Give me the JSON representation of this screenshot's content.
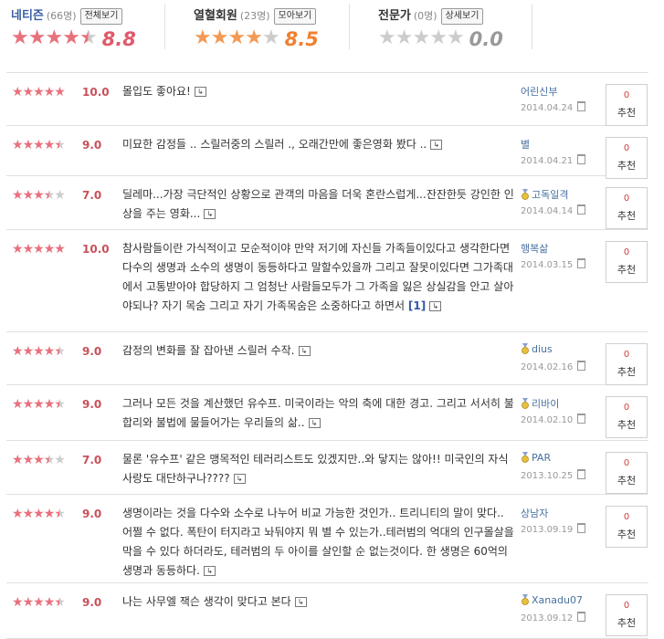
{
  "summary": {
    "groups": [
      {
        "label": "네티즌",
        "count": "(66명)",
        "button": "전체보기",
        "stars": "4.5",
        "score": "8.8",
        "score_color": "#e05a6a",
        "star_color": "#e8707c"
      },
      {
        "label": "열혈회원",
        "count": "(23명)",
        "button": "모아보기",
        "stars": "4",
        "score": "8.5",
        "score_color": "#f08030",
        "star_color": "#f39a55"
      },
      {
        "label": "전문가",
        "count": "(0명)",
        "button": "상세보기",
        "stars": "0",
        "score": "0.0",
        "score_color": "#999999",
        "star_color": "#cccccc"
      }
    ]
  },
  "reviews": [
    {
      "stars": "5",
      "score": "10.0",
      "text": "몰입도 좋아요!",
      "ref": "",
      "user": "어린신부",
      "medal": false,
      "date": "2014.04.24",
      "rec_count": "0",
      "rec_label": "추천"
    },
    {
      "stars": "4.5",
      "score": "9.0",
      "text": "미묘한 감정들 .. 스릴러중의 스릴러 ., 오래간만에 좋은영화 봤다 ..",
      "ref": "",
      "user": "별",
      "medal": false,
      "date": "2014.04.21",
      "rec_count": "0",
      "rec_label": "추천"
    },
    {
      "stars": "3.5",
      "score": "7.0",
      "text": "딜레마...가장 극단적인 상황으로 관객의 마음을 더욱 혼란스럽게...잔잔한듯 강인한 인상을 주는 영화...",
      "ref": "",
      "user": "고독일격",
      "medal": true,
      "date": "2014.04.14",
      "rec_count": "0",
      "rec_label": "추천"
    },
    {
      "stars": "5",
      "score": "10.0",
      "text": "참사람들이란 가식적이고 모순적이야 만약 저기에 자신들 가족들이있다고 생각한다면 다수의 생명과 소수의 생명이 동등하다고 말할수있을까 그리고 잘못이있다면 그가족대에서 고통받아야 합당하지 그 엄청난 사람들모두가 그 가족을 잃은 상실감을 안고 살아야되나? 자기 목숨 그리고 자기 가족목숨은 소중하다고 하면서",
      "ref": "[1]",
      "user": "행복삶",
      "medal": false,
      "date": "2014.03.15",
      "rec_count": "0",
      "rec_label": "추천"
    },
    {
      "stars": "4.5",
      "score": "9.0",
      "text": "감정의 변화를 잘 잡아낸 스릴러 수작.",
      "ref": "",
      "user": "dius",
      "medal": true,
      "date": "2014.02.16",
      "rec_count": "0",
      "rec_label": "추천"
    },
    {
      "stars": "4.5",
      "score": "9.0",
      "text": "그러나 모든 것을 계산했던 유수프. 미국이라는 악의 축에 대한 경고. 그리고 서서히 불합리와 불법에 물들어가는 우리들의 삶..",
      "ref": "",
      "user": "리바이",
      "medal": true,
      "date": "2014.02.10",
      "rec_count": "0",
      "rec_label": "추천"
    },
    {
      "stars": "3.5",
      "score": "7.0",
      "text": "물론 '유수프' 같은 맹목적인 테러리스트도 있겠지만..와 닿지는 않아!! 미국인의 자식사랑도 대단하구나????",
      "ref": "",
      "user": "PAR",
      "medal": true,
      "date": "2013.10.25",
      "rec_count": "0",
      "rec_label": "추천"
    },
    {
      "stars": "4.5",
      "score": "9.0",
      "text": "생명이라는 것을 다수와 소수로 나누어 비교 가능한 것인가.. 트리니티의 말이 맞다.. 어쩔 수 없다. 폭탄이 터지라고 놔둬야지 뭐 별 수 있는가..테러범의 억대의 인구몰살을 막을 수 있다 하더라도, 테러범의 두 아이를 살인할 순 없는것이다. 한 생명은 60억의 생명과 동등하다.",
      "ref": "",
      "user": "상남자",
      "medal": false,
      "date": "2013.09.19",
      "rec_count": "0",
      "rec_label": "추천"
    },
    {
      "stars": "4.5",
      "score": "9.0",
      "text": "나는 사무엘 잭슨 생각이 맞다고 본다",
      "ref": "",
      "user": "Xanadu07",
      "medal": true,
      "date": "2013.09.12",
      "rec_count": "0",
      "rec_label": "추천"
    }
  ]
}
